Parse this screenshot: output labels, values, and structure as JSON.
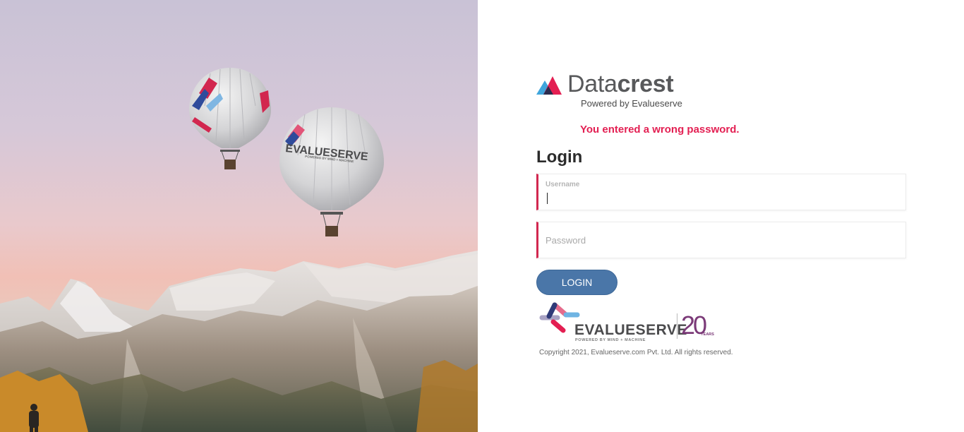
{
  "brand": {
    "name_light": "Data",
    "name_bold": "crest",
    "tagline": "Powered by Evalueserve"
  },
  "error_message": "You entered a wrong password.",
  "login": {
    "title": "Login",
    "username_label": "Username",
    "username_value": "",
    "password_placeholder": "Password",
    "button_label": "LOGIN"
  },
  "hero": {
    "balloon_brand": "EVALUESERVE",
    "balloon_tagline": "POWERED BY MIND + MACHINE"
  },
  "footer": {
    "logo_name": "EVALUESERVE",
    "logo_tagline": "POWERED BY MIND + MACHINE",
    "anniversary": "20",
    "anniversary_unit": "YEARS",
    "copyright": "Copyright 2021, Evalueserve.com Pvt. Ltd. All rights reserved."
  },
  "colors": {
    "accent_red": "#e31f52",
    "field_border": "#d2274f",
    "button_blue": "#4a76a8",
    "anniversary_purple": "#7b3a78"
  }
}
